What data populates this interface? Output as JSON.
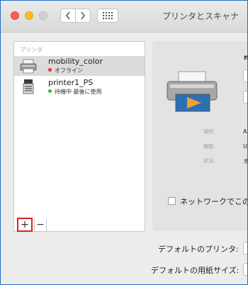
{
  "window": {
    "title": "プリンタとスキャナ"
  },
  "printer_list": {
    "header": "プリンタ",
    "items": [
      {
        "name": "mobility_color",
        "status": "オフライン",
        "status_color": "#e0392f",
        "selected": true
      },
      {
        "name": "printer1_PS",
        "status": "待機中 最後に使用",
        "status_color": "#2cb742",
        "selected": false
      }
    ],
    "add_label": "+",
    "remove_label": "−"
  },
  "detail": {
    "name": "m",
    "location_label": "場所:",
    "location_value": "A",
    "kind_label": "種類:",
    "kind_value": "U",
    "status_label": "状況:",
    "status_value": "オ",
    "network_share_label": "ネットワークでこの"
  },
  "defaults": {
    "default_printer_label": "デフォルトのプリンタ:",
    "default_paper_label": "デフォルトの用紙サイズ:"
  },
  "colors": {
    "add_button_highlight": "#e02020",
    "accent_border": "#1f6fc8"
  }
}
